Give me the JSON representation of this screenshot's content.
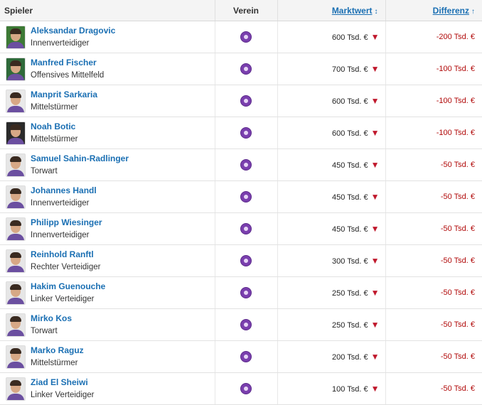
{
  "header": {
    "player": "Spieler",
    "club": "Verein",
    "market_value": "Marktwert",
    "market_value_sort": "↕",
    "difference": "Differenz",
    "difference_sort": "↑"
  },
  "rows": [
    {
      "name": "Aleksandar Dragovic",
      "position": "Innenverteidiger",
      "value": "600 Tsd. €",
      "diff": "-200 Tsd. €",
      "portrait_bg": "#3d7a35"
    },
    {
      "name": "Manfred Fischer",
      "position": "Offensives Mittelfeld",
      "value": "700 Tsd. €",
      "diff": "-100 Tsd. €",
      "portrait_bg": "#2f6a3a"
    },
    {
      "name": "Manprit Sarkaria",
      "position": "Mittelstürmer",
      "value": "600 Tsd. €",
      "diff": "-100 Tsd. €",
      "portrait_bg": "#e9e9e9"
    },
    {
      "name": "Noah Botic",
      "position": "Mittelstürmer",
      "value": "600 Tsd. €",
      "diff": "-100 Tsd. €",
      "portrait_bg": "#2a2a2a"
    },
    {
      "name": "Samuel Sahin-Radlinger",
      "position": "Torwart",
      "value": "450 Tsd. €",
      "diff": "-50 Tsd. €",
      "portrait_bg": "#e6e6e6"
    },
    {
      "name": "Johannes Handl",
      "position": "Innenverteidiger",
      "value": "450 Tsd. €",
      "diff": "-50 Tsd. €",
      "portrait_bg": "#e6e6e6"
    },
    {
      "name": "Philipp Wiesinger",
      "position": "Innenverteidiger",
      "value": "450 Tsd. €",
      "diff": "-50 Tsd. €",
      "portrait_bg": "#e6e6e6"
    },
    {
      "name": "Reinhold Ranftl",
      "position": "Rechter Verteidiger",
      "value": "300 Tsd. €",
      "diff": "-50 Tsd. €",
      "portrait_bg": "#e6e6e6"
    },
    {
      "name": "Hakim Guenouche",
      "position": "Linker Verteidiger",
      "value": "250 Tsd. €",
      "diff": "-50 Tsd. €",
      "portrait_bg": "#e6e6e6"
    },
    {
      "name": "Mirko Kos",
      "position": "Torwart",
      "value": "250 Tsd. €",
      "diff": "-50 Tsd. €",
      "portrait_bg": "#e6e6e6"
    },
    {
      "name": "Marko Raguz",
      "position": "Mittelstürmer",
      "value": "200 Tsd. €",
      "diff": "-50 Tsd. €",
      "portrait_bg": "#e6e6e6"
    },
    {
      "name": "Ziad El Sheiwi",
      "position": "Linker Verteidiger",
      "value": "100 Tsd. €",
      "diff": "-50 Tsd. €",
      "portrait_bg": "#e6e6e6"
    }
  ]
}
